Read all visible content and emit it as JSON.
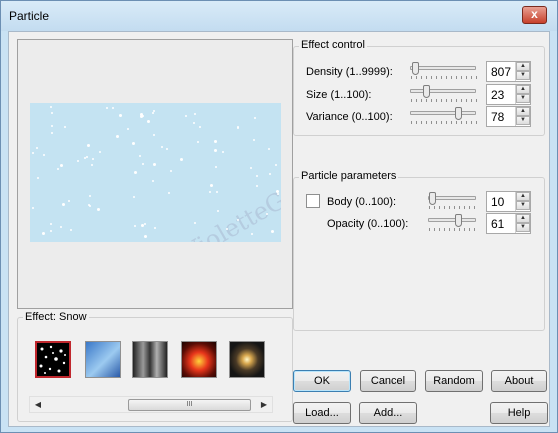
{
  "window": {
    "title": "Particle",
    "close_label": "x"
  },
  "preview": {
    "watermark": "VioletteGraphic"
  },
  "effect": {
    "label": "Effect: Snow",
    "thumbnails": [
      {
        "name": "snow",
        "selected": true
      },
      {
        "name": "sky",
        "selected": false
      },
      {
        "name": "smoke",
        "selected": false
      },
      {
        "name": "fire",
        "selected": false
      },
      {
        "name": "sparkle",
        "selected": false
      }
    ],
    "scroll_thumb_glyph": "III"
  },
  "effect_control": {
    "title": "Effect control",
    "density": {
      "label": "Density (1..9999):",
      "value": "807"
    },
    "size": {
      "label": "Size (1..100):",
      "value": "23"
    },
    "variance": {
      "label": "Variance (0..100):",
      "value": "78"
    }
  },
  "particle_parameters": {
    "title": "Particle parameters",
    "body": {
      "label": "Body (0..100):",
      "value": "10",
      "checked": false
    },
    "opacity": {
      "label": "Opacity (0..100):",
      "value": "61"
    }
  },
  "buttons": {
    "ok": "OK",
    "cancel": "Cancel",
    "random": "Random",
    "about": "About",
    "load": "Load...",
    "add": "Add...",
    "help": "Help"
  }
}
